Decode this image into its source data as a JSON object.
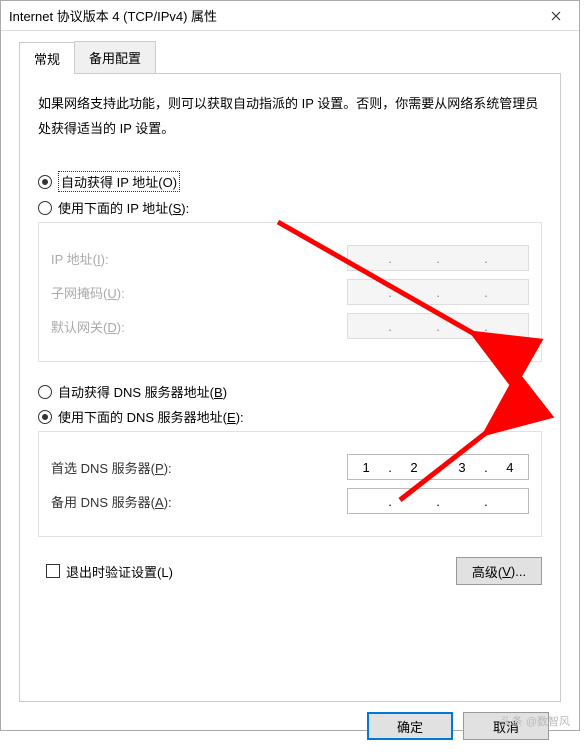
{
  "title": "Internet 协议版本 4 (TCP/IPv4) 属性",
  "tabs": {
    "general": "常规",
    "alt": "备用配置"
  },
  "description": "如果网络支持此功能，则可以获取自动指派的 IP 设置。否则，你需要从网络系统管理员处获得适当的 IP 设置。",
  "ip": {
    "auto": "自动获得 IP 地址(O)",
    "manual_prefix": "使用下面的 IP 地址(",
    "manual_ul": "S",
    "manual_suffix": "):",
    "addr_prefix": "IP 地址(",
    "addr_ul": "I",
    "addr_suffix": "):",
    "mask_prefix": "子网掩码(",
    "mask_ul": "U",
    "mask_suffix": "):",
    "gw_prefix": "默认网关(",
    "gw_ul": "D",
    "gw_suffix": "):"
  },
  "dns": {
    "auto_prefix": "自动获得 DNS 服务器地址(",
    "auto_ul": "B",
    "auto_suffix": ")",
    "manual_prefix": "使用下面的 DNS 服务器地址(",
    "manual_ul": "E",
    "manual_suffix": "):",
    "pref_prefix": "首选 DNS 服务器(",
    "pref_ul": "P",
    "pref_suffix": "):",
    "pref_value": {
      "o1": "1",
      "o2": "2",
      "o3": "3",
      "o4": "4"
    },
    "alt_prefix": "备用 DNS 服务器(",
    "alt_ul": "A",
    "alt_suffix": "):"
  },
  "validate_prefix": "退出时验证设置(",
  "validate_ul": "L",
  "validate_suffix": ")",
  "advanced_prefix": "高级(",
  "advanced_ul": "V",
  "advanced_suffix": ")...",
  "ok": "确定",
  "cancel": "取消",
  "watermark": "头条 @数智风"
}
